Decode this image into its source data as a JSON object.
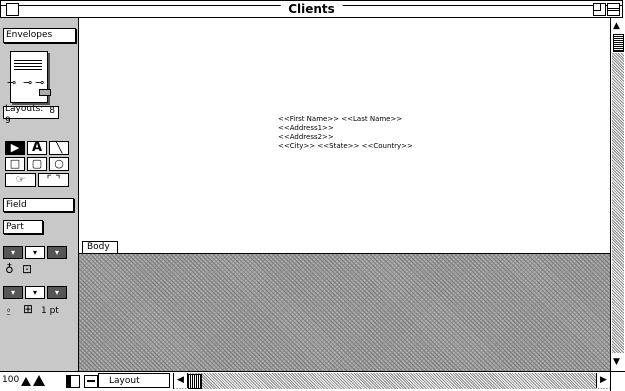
{
  "window": {
    "title": "Clients"
  },
  "status": {
    "layout_menu": "Envelopes",
    "book_page_arrow": "8",
    "layouts_label": "Layouts:",
    "layouts_count": "9",
    "field_button": "Field",
    "part_button": "Part",
    "line_width": "1 pt"
  },
  "tools": {
    "pointer": "▶",
    "text": "A",
    "line": "╲",
    "rect": "□",
    "rounded_rect": "▢",
    "oval": "○",
    "button": "☞",
    "portal": "⌜ ⌝"
  },
  "layout": {
    "part_label": "Body",
    "merge_lines": [
      "<<First Name>> <<Last Name>>",
      "<<Address1>>",
      "<<Address2>>",
      "<<City>> <<State>> <<Country>>"
    ]
  },
  "bottom": {
    "zoom_level": "100",
    "mode": "Layout"
  },
  "colors": {
    "panel": "#c8c8c8",
    "canvas": "#ffffff",
    "nonprint_area": "#9a9a9a"
  }
}
